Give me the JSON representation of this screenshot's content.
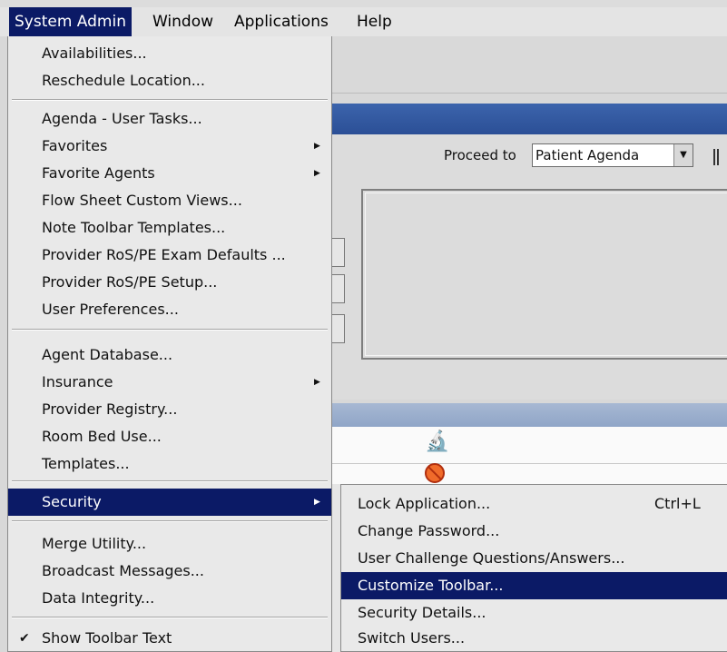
{
  "menubar": {
    "items": [
      "System Admin",
      "Window",
      "Applications",
      "Help"
    ]
  },
  "proceed": {
    "label": "Proceed to",
    "value": "Patient Agenda"
  },
  "system_admin_menu": {
    "availabilities": "Availabilities...",
    "reschedule_location": "Reschedule Location...",
    "agenda_user_tasks": "Agenda - User Tasks...",
    "favorites": "Favorites",
    "favorite_agents": "Favorite Agents",
    "flow_sheet_custom_views": "Flow Sheet Custom Views...",
    "note_toolbar_templates": "Note Toolbar Templates...",
    "provider_ros_pe_exam_defaults": "Provider RoS/PE Exam Defaults ...",
    "provider_ros_pe_setup": "Provider RoS/PE Setup...",
    "user_preferences": "User Preferences...",
    "agent_database": "Agent Database...",
    "insurance": "Insurance",
    "provider_registry": "Provider Registry...",
    "room_bed_use": "Room Bed Use...",
    "templates": "Templates...",
    "security": "Security",
    "merge_utility": "Merge Utility...",
    "broadcast_messages": "Broadcast Messages...",
    "data_integrity": "Data Integrity...",
    "show_toolbar_text": "Show Toolbar Text"
  },
  "security_submenu": {
    "lock_application": "Lock Application...",
    "lock_shortcut": "Ctrl+L",
    "change_password": "Change Password...",
    "user_challenge": "User Challenge Questions/Answers...",
    "customize_toolbar": "Customize Toolbar...",
    "security_details": "Security Details...",
    "switch_users": "Switch Users..."
  },
  "colors": {
    "menu_highlight": "#0b1a66",
    "title_bar": "#2b4f96",
    "menu_background": "#e9e9e9"
  }
}
